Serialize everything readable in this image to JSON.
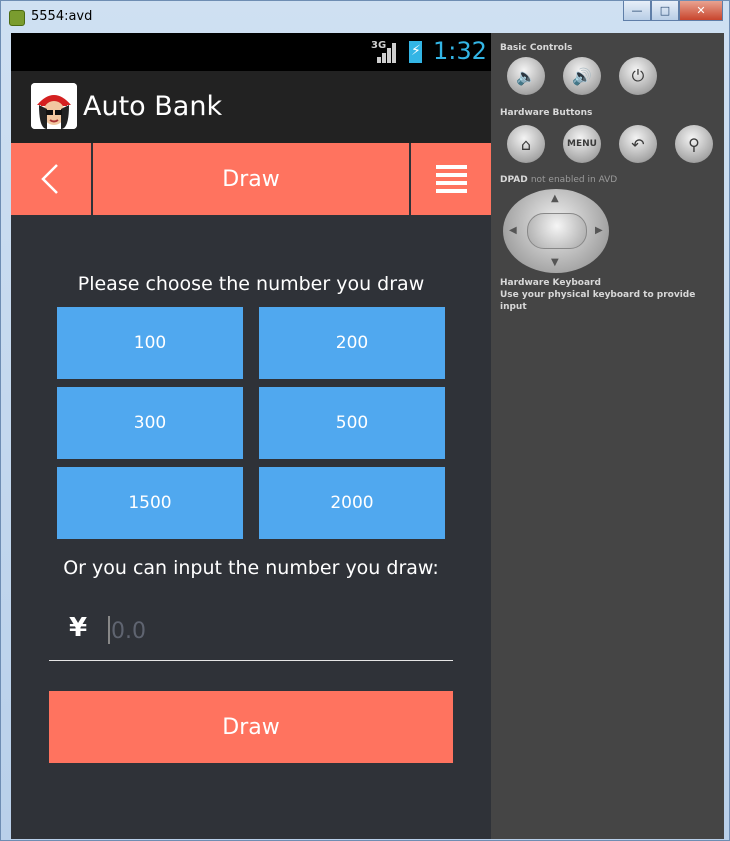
{
  "window": {
    "title": "5554:avd",
    "minimize_icon": "minimize-icon",
    "maximize_icon": "maximize-icon",
    "close_icon": "close-icon"
  },
  "status_bar": {
    "network": "3G",
    "time": "1:32"
  },
  "action_bar": {
    "app_title": "Auto Bank"
  },
  "nav": {
    "title": "Draw",
    "back_icon": "chevron-left-icon",
    "menu_icon": "hamburger-menu-icon"
  },
  "main": {
    "prompt": "Please choose the number you draw",
    "amounts": [
      "100",
      "200",
      "300",
      "500",
      "1500",
      "2000"
    ],
    "input_prompt": "Or you can input the number you draw:",
    "currency_symbol": "¥",
    "amount_placeholder": "0.0",
    "draw_button": "Draw"
  },
  "panel": {
    "basic_controls": "Basic Controls",
    "hardware_buttons": "Hardware Buttons",
    "menu_label": "MENU",
    "dpad_label": "DPAD",
    "dpad_note": "not enabled in AVD",
    "keyboard_title": "Hardware Keyboard",
    "keyboard_desc": "Use your physical keyboard to provide input"
  },
  "colors": {
    "accent": "#ff735f",
    "amount_button": "#50a8ef",
    "background": "#2f3238",
    "clock": "#33b5e5"
  }
}
